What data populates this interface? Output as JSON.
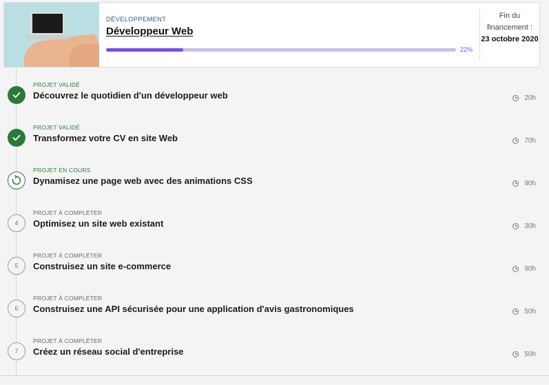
{
  "course": {
    "category": "DÉVELOPPEMENT",
    "title": "Développeur Web",
    "progress_label": "22%",
    "progress": 0.22,
    "funding_label": "Fin du financement :",
    "funding_date": "23 octobre 2020"
  },
  "colors": {
    "accent": "#7451eb",
    "success": "#2b7a3a"
  },
  "steps": [
    {
      "status": "PROJET VALIDÉ",
      "name": "Découvrez le quotidien d'un développeur web",
      "duration": "20h",
      "state": "done",
      "icon": "checkmark-icon"
    },
    {
      "status": "PROJET VALIDÉ",
      "name": "Transformez votre CV en site Web",
      "duration": "70h",
      "state": "done",
      "icon": "checkmark-icon"
    },
    {
      "status": "PROJET EN COURS",
      "name": "Dynamisez une page web avec des animations CSS",
      "duration": "90h",
      "state": "progress",
      "icon": "refresh-icon"
    },
    {
      "status": "PROJET À COMPLÉTER",
      "name": "Optimisez un site web existant",
      "duration": "30h",
      "state": "todo",
      "number": "4"
    },
    {
      "status": "PROJET À COMPLÉTER",
      "name": "Construisez un site e-commerce",
      "duration": "90h",
      "state": "todo",
      "number": "5"
    },
    {
      "status": "PROJET À COMPLÉTER",
      "name": "Construisez une API sécurisée pour une application d'avis gastronomiques",
      "duration": "50h",
      "state": "todo",
      "number": "6"
    },
    {
      "status": "PROJET À COMPLÉTER",
      "name": "Créez un réseau social d'entreprise",
      "duration": "50h",
      "state": "todo",
      "number": "7"
    }
  ]
}
